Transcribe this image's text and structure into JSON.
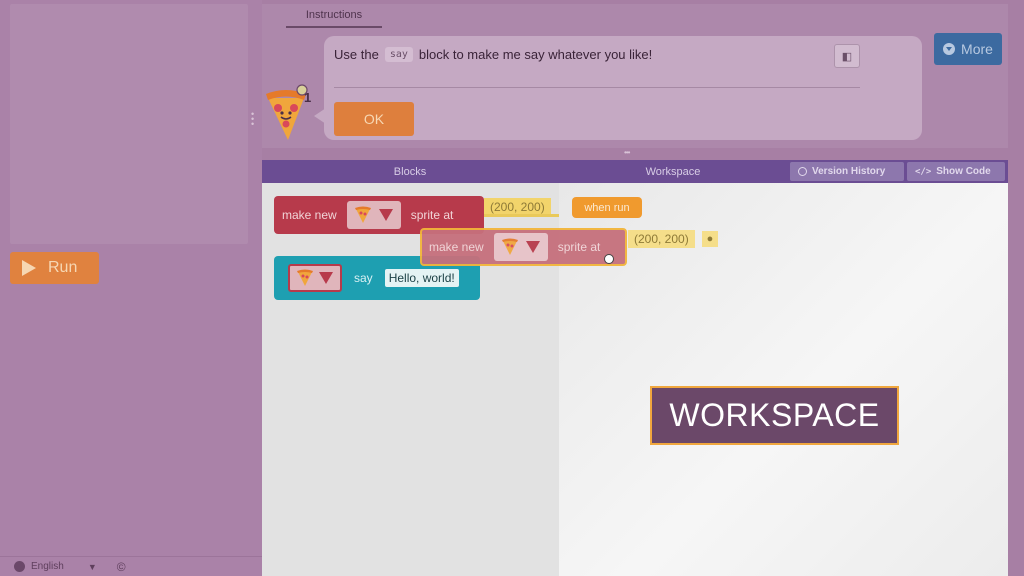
{
  "left": {
    "run_label": "Run",
    "language": "English",
    "copyright_icon": "©"
  },
  "instructions": {
    "tab_label": "Instructions",
    "text_before": "Use the",
    "code_word": "say",
    "text_after": "block to make me say whatever you like!",
    "ok_label": "OK",
    "avatar_badge": "1",
    "more_label": "More"
  },
  "editor": {
    "blocks_header": "Blocks",
    "workspace_header": "Workspace",
    "version_history_label": "Version History",
    "show_code_label": "Show Code"
  },
  "blocks": {
    "make_new_1": "make new",
    "sprite_at_1": "sprite at",
    "coord_1": "(200, 200)",
    "say_label": "say",
    "hello_text": "Hello, world!",
    "when_run": "when run",
    "make_new_2": "make new",
    "sprite_at_2": "sprite at",
    "coord_2": "(200, 200)"
  },
  "overlay": {
    "workspace_title": "WORKSPACE"
  },
  "colors": {
    "accent_orange": "#de7f3d",
    "header_purple": "#6b4d93",
    "block_red": "#b73a4b",
    "block_teal": "#1e9fb1",
    "block_yellow": "#f2d46b",
    "more_blue": "#3c6aa0"
  }
}
